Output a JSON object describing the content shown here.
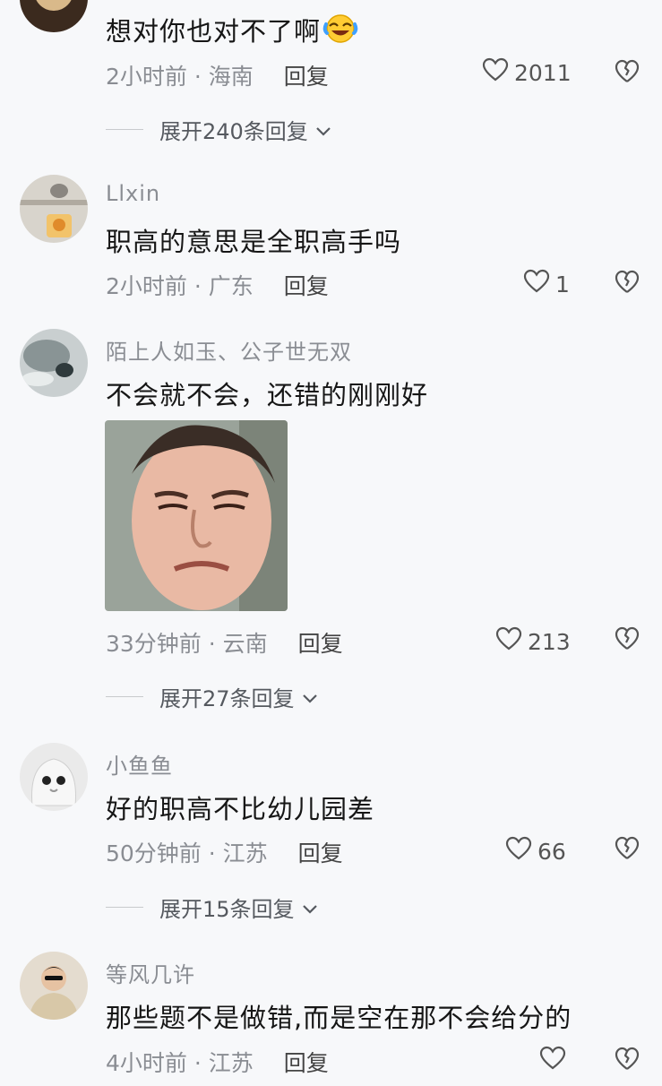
{
  "comments": [
    {
      "username": "",
      "text": "想对你也对不了啊",
      "time": "2小时前",
      "location": "海南",
      "reply_label": "回复",
      "likes": "2011",
      "expand": "展开240条回复"
    },
    {
      "username": "Llxin",
      "text": "职高的意思是全职高手吗",
      "time": "2小时前",
      "location": "广东",
      "reply_label": "回复",
      "likes": "1"
    },
    {
      "username": "陌上人如玉、公子世无双",
      "text": "不会就不会，还错的刚刚好",
      "time": "33分钟前",
      "location": "云南",
      "reply_label": "回复",
      "likes": "213",
      "expand": "展开27条回复"
    },
    {
      "username": "小鱼鱼",
      "text": "好的职高不比幼儿园差",
      "time": "50分钟前",
      "location": "江苏",
      "reply_label": "回复",
      "likes": "66",
      "expand": "展开15条回复"
    },
    {
      "username": "等风几许",
      "text": "那些题不是做错,而是空在那不会给分的",
      "time": "4小时前",
      "location": "江苏",
      "reply_label": "回复",
      "likes": ""
    }
  ],
  "separator": " · ",
  "icons": {
    "like": "heart-outline-icon",
    "dislike": "broken-heart-icon",
    "expand": "chevron-down-icon",
    "emoji": "laughing-crying-emoji"
  },
  "colors": {
    "background": "#f7f8fa",
    "meta": "#8a8d93",
    "text": "#161616"
  }
}
